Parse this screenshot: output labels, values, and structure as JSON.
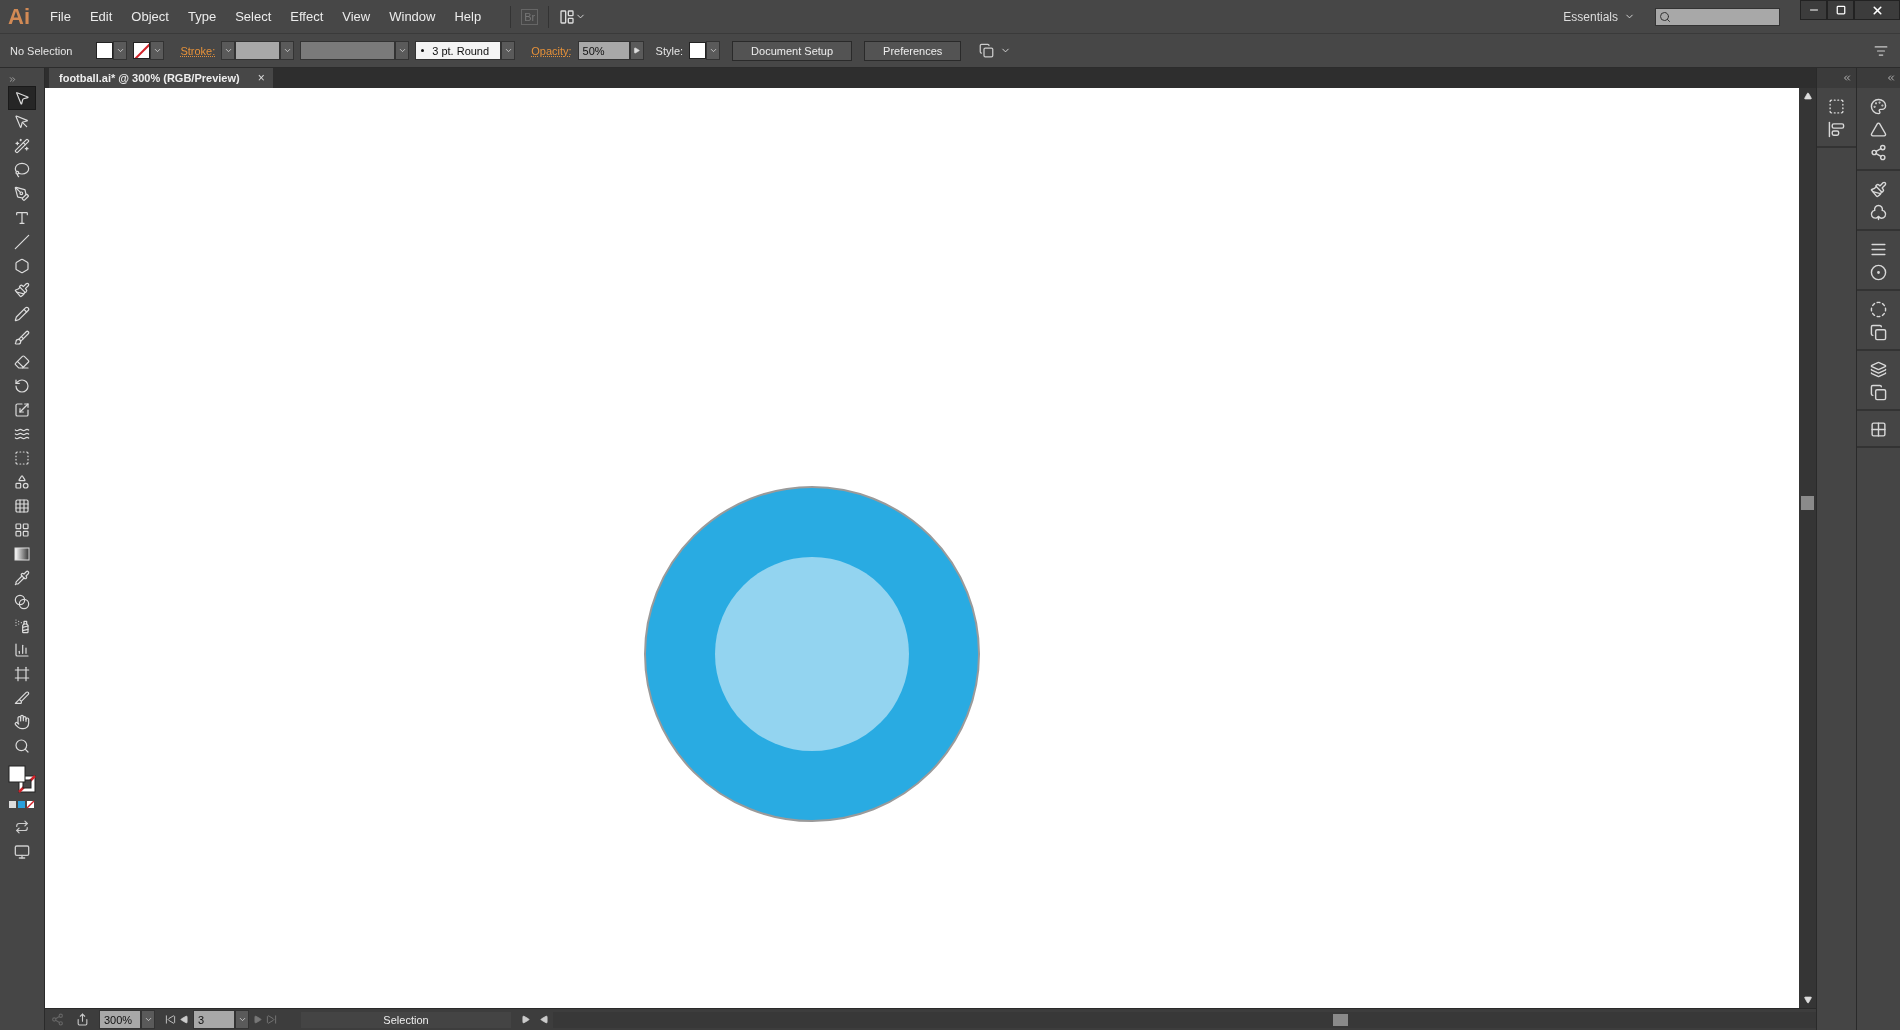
{
  "app": {
    "logo": "Ai"
  },
  "menu": [
    "File",
    "Edit",
    "Object",
    "Type",
    "Select",
    "Effect",
    "View",
    "Window",
    "Help"
  ],
  "bridge": {
    "label": "Br"
  },
  "workspace": {
    "label": "Essentials"
  },
  "control_bar": {
    "selection": "No Selection",
    "stroke_label": "Stroke:",
    "brush": "3 pt. Round",
    "opacity_label": "Opacity:",
    "opacity": "50%",
    "style_label": "Style:",
    "buttons": [
      "Document Setup",
      "Preferences"
    ]
  },
  "document_tab": {
    "title": "football.ai* @ 300% (RGB/Preview)",
    "close": "×"
  },
  "tools": [
    {
      "kind": "selection",
      "selected": true
    },
    {
      "kind": "direct-selection",
      "selected": false
    },
    {
      "kind": "magic-wand",
      "selected": false
    },
    {
      "kind": "lasso",
      "selected": false
    },
    {
      "kind": "pen",
      "selected": false
    },
    {
      "kind": "type",
      "selected": false
    },
    {
      "kind": "line",
      "selected": false
    },
    {
      "kind": "polygon",
      "selected": false
    },
    {
      "kind": "paintbrush",
      "selected": false
    },
    {
      "kind": "pencil",
      "selected": false
    },
    {
      "kind": "blob-brush",
      "selected": false
    },
    {
      "kind": "eraser",
      "selected": false
    },
    {
      "kind": "rotate",
      "selected": false
    },
    {
      "kind": "scale",
      "selected": false
    },
    {
      "kind": "width",
      "selected": false
    },
    {
      "kind": "free-transform",
      "selected": false
    },
    {
      "kind": "shape-builder",
      "selected": false
    },
    {
      "kind": "perspective",
      "selected": false
    },
    {
      "kind": "mesh",
      "selected": false
    },
    {
      "kind": "gradient",
      "selected": false
    },
    {
      "kind": "eyedropper",
      "selected": false
    },
    {
      "kind": "blend",
      "selected": false
    },
    {
      "kind": "sprayer",
      "selected": false
    },
    {
      "kind": "graph",
      "selected": false
    },
    {
      "kind": "artboard",
      "selected": false
    },
    {
      "kind": "slice",
      "selected": false
    },
    {
      "kind": "hand",
      "selected": false
    },
    {
      "kind": "zoom",
      "selected": false
    }
  ],
  "status_bar": {
    "zoom": "300%",
    "artboard": "3",
    "status": "Selection"
  }
}
